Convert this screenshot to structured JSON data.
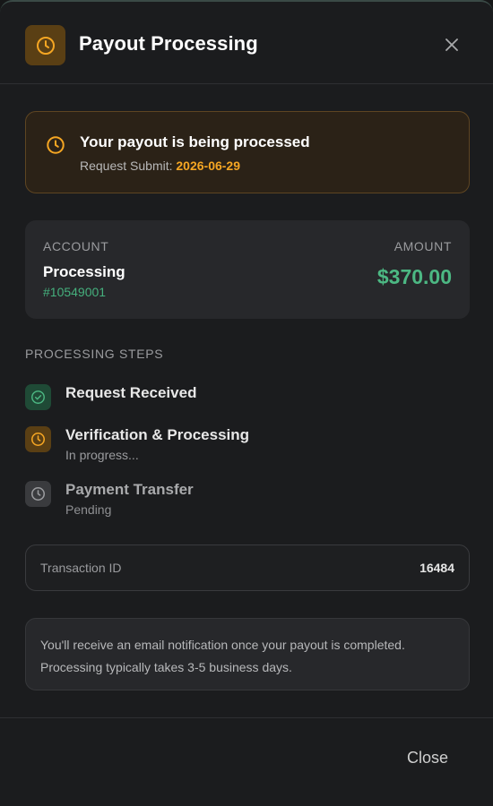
{
  "header": {
    "title": "Payout Processing",
    "icon": "clock-icon",
    "close_icon": "close-icon"
  },
  "banner": {
    "title": "Your payout is being processed",
    "submit_label": "Request Submit:",
    "submit_date": "2026-06-29"
  },
  "account": {
    "account_label": "ACCOUNT",
    "amount_label": "AMOUNT",
    "name": "Processing",
    "number": "#10549001",
    "amount": "$370.00"
  },
  "steps": {
    "heading": "PROCESSING STEPS",
    "items": [
      {
        "title": "Request Received",
        "subtitle": "",
        "status": "complete",
        "icon": "check-circle-icon"
      },
      {
        "title": "Verification & Processing",
        "subtitle": "In progress...",
        "status": "in-progress",
        "icon": "clock-icon"
      },
      {
        "title": "Payment Transfer",
        "subtitle": "Pending",
        "status": "pending",
        "icon": "clock-icon"
      }
    ]
  },
  "transaction": {
    "label": "Transaction ID",
    "value": "16484"
  },
  "note": {
    "text": "You'll receive an email notification once your payout is completed. Processing typically takes 3-5 business days."
  },
  "footer": {
    "close_label": "Close"
  },
  "colors": {
    "accent_orange": "#f5a623",
    "accent_green": "#4cb883",
    "background": "#1b1c1e"
  }
}
